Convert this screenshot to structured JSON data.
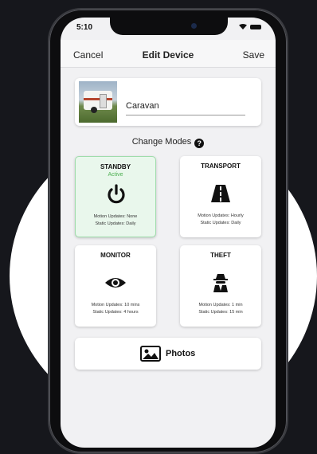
{
  "status": {
    "time": "5:10"
  },
  "navbar": {
    "cancel": "Cancel",
    "title": "Edit Device",
    "save": "Save"
  },
  "device": {
    "name": "Caravan"
  },
  "modes_header": {
    "label": "Change Modes",
    "help_glyph": "?"
  },
  "modes": [
    {
      "title": "STANDBY",
      "status": "Active",
      "icon": "power-icon",
      "motion": "Motion Updates: None",
      "static": "Static Updates: Daily"
    },
    {
      "title": "TRANSPORT",
      "status": "",
      "icon": "road-icon",
      "motion": "Motion Updates: Hourly",
      "static": "Static Updates: Daily"
    },
    {
      "title": "MONITOR",
      "status": "",
      "icon": "eye-icon",
      "motion": "Motion Updates: 10 mins",
      "static": "Static Updates: 4 hours"
    },
    {
      "title": "THEFT",
      "status": "",
      "icon": "spy-icon",
      "motion": "Motion Updates: 1 min",
      "static": "Static Updates: 15 min"
    }
  ],
  "photos_button": {
    "label": "Photos",
    "icon": "image-icon"
  },
  "colors": {
    "active_bg": "#e9f7ec",
    "active_text": "#4caf50",
    "background": "#16171c"
  }
}
